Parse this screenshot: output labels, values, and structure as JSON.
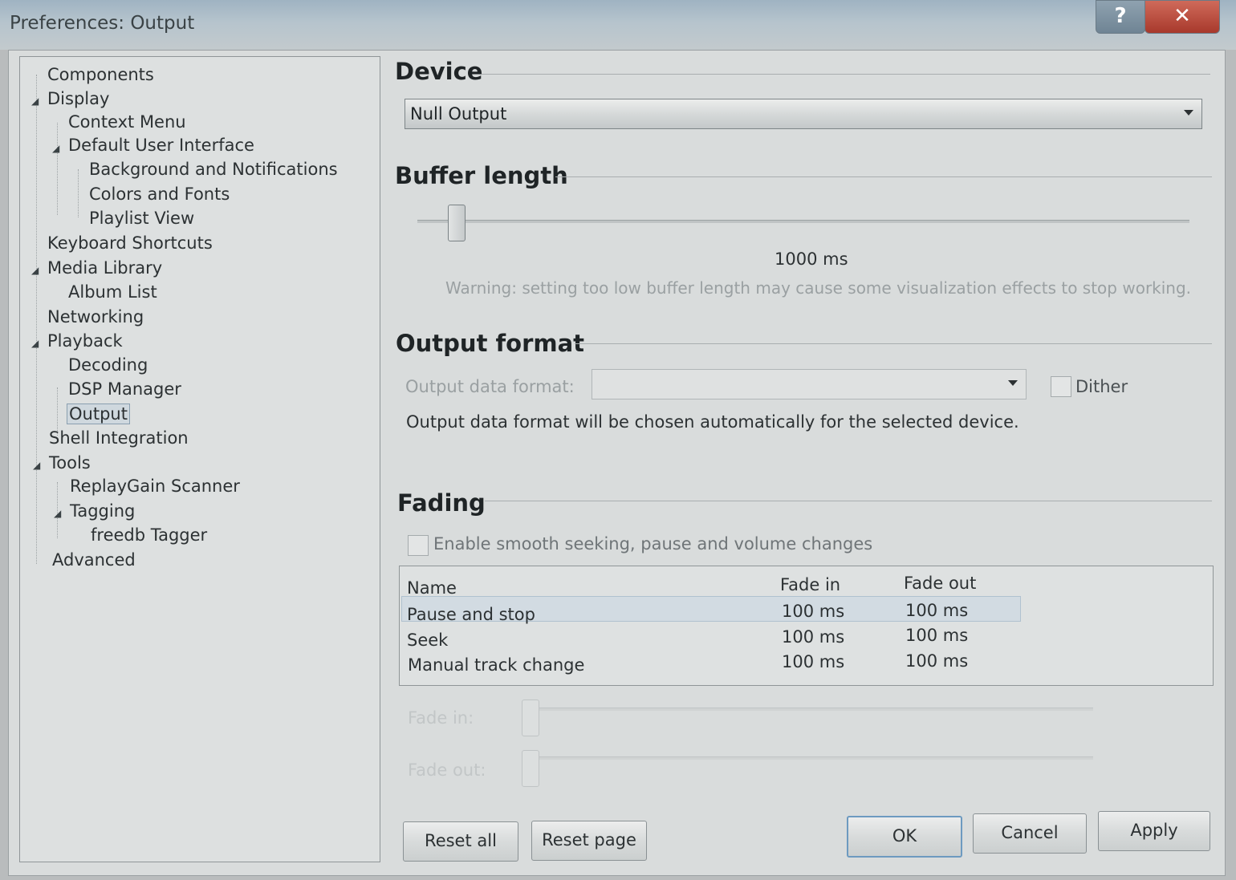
{
  "window": {
    "title": "Preferences: Output",
    "help_glyph": "?",
    "close_glyph": "✕"
  },
  "tree": {
    "items": [
      {
        "label": "Components"
      },
      {
        "label": "Display"
      },
      {
        "label": "Context Menu"
      },
      {
        "label": "Default User Interface"
      },
      {
        "label": "Background and Notifications"
      },
      {
        "label": "Colors and Fonts"
      },
      {
        "label": "Playlist View"
      },
      {
        "label": "Keyboard Shortcuts"
      },
      {
        "label": "Media Library"
      },
      {
        "label": "Album List"
      },
      {
        "label": "Networking"
      },
      {
        "label": "Playback"
      },
      {
        "label": "Decoding"
      },
      {
        "label": "DSP Manager"
      },
      {
        "label": "Output"
      },
      {
        "label": "Shell Integration"
      },
      {
        "label": "Tools"
      },
      {
        "label": "ReplayGain Scanner"
      },
      {
        "label": "Tagging"
      },
      {
        "label": "freedb Tagger"
      },
      {
        "label": "Advanced"
      }
    ],
    "selected": "Output"
  },
  "device": {
    "section_title": "Device",
    "selected_value": "Null Output"
  },
  "buffer": {
    "section_title": "Buffer length",
    "value_label": "1000 ms",
    "level_fraction": 0.04,
    "warning": "Warning: setting too low buffer length may cause some visualization effects to stop working."
  },
  "output_format": {
    "section_title": "Output format",
    "field_label": "Output data format:",
    "field_value": "",
    "dither_label": "Dither",
    "dither_checked": false,
    "info": "Output data format will be chosen automatically for the selected device."
  },
  "fading": {
    "section_title": "Fading",
    "enable_label": "Enable smooth seeking, pause and volume changes",
    "enable_checked": false,
    "columns": [
      "Name",
      "Fade in",
      "Fade out"
    ],
    "rows": [
      {
        "name": "Pause and stop",
        "fade_in": "100 ms",
        "fade_out": "100 ms"
      },
      {
        "name": "Seek",
        "fade_in": "100 ms",
        "fade_out": "100 ms"
      },
      {
        "name": "Manual track change",
        "fade_in": "100 ms",
        "fade_out": "100 ms"
      }
    ],
    "fade_in_label": "Fade in:",
    "fade_out_label": "Fade out:"
  },
  "buttons": {
    "reset_all": "Reset all",
    "reset_page": "Reset page",
    "ok": "OK",
    "cancel": "Cancel",
    "apply": "Apply"
  }
}
